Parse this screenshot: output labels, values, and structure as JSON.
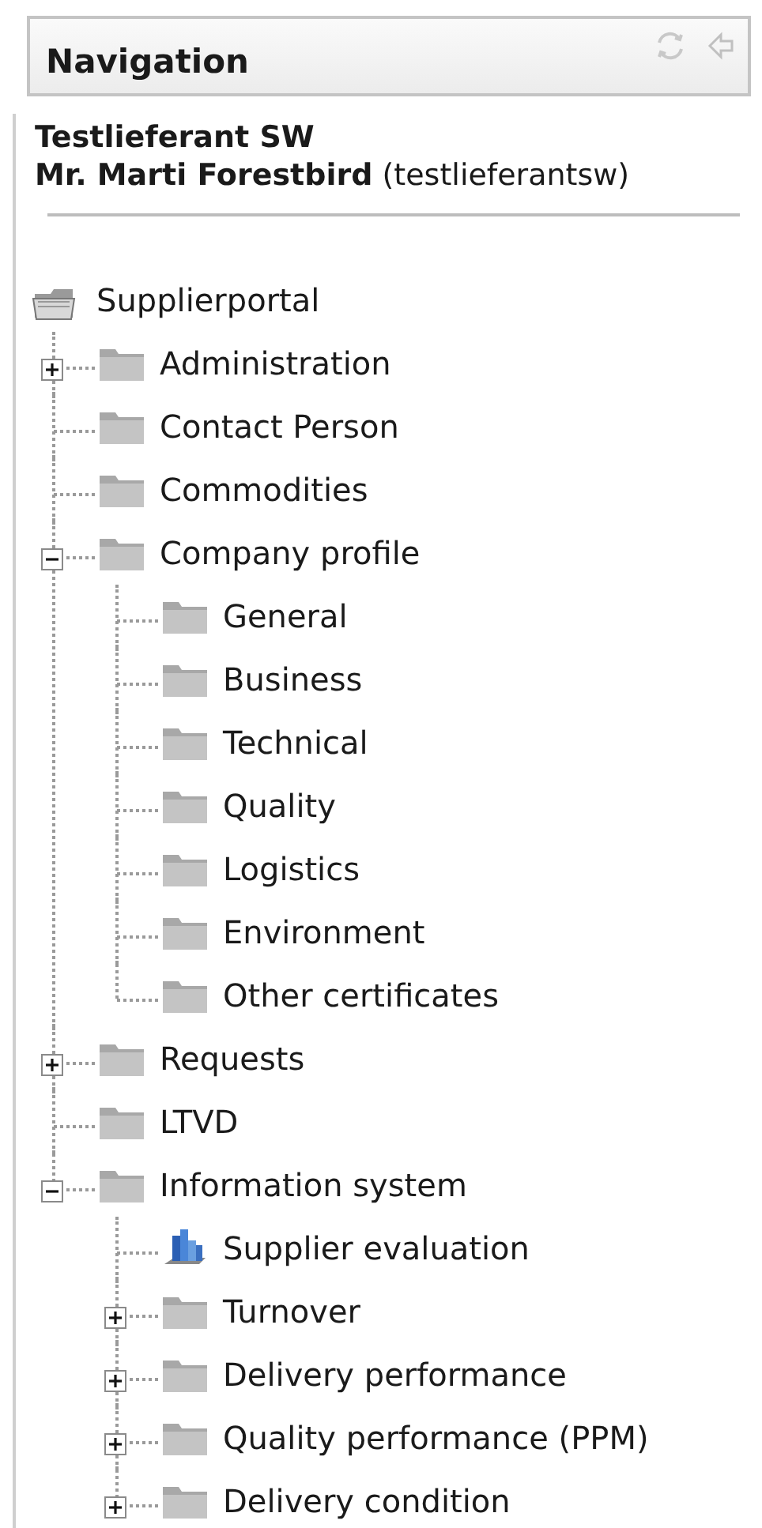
{
  "panel": {
    "title": "Navigation"
  },
  "user": {
    "company": "Testlieferant SW",
    "name": "**Mr. Marti Forestbird** (testlieferantsw)"
  },
  "tree": {
    "label": "Supplierportal",
    "kind": "root",
    "children": [
      {
        "label": "Administration",
        "kind": "folder",
        "expanded": false
      },
      {
        "label": "Contact Person",
        "kind": "folder"
      },
      {
        "label": "Commodities",
        "kind": "folder"
      },
      {
        "label": "Company profile",
        "kind": "folder",
        "expanded": true,
        "children": [
          {
            "label": "General",
            "kind": "folder"
          },
          {
            "label": "Business",
            "kind": "folder"
          },
          {
            "label": "Technical",
            "kind": "folder"
          },
          {
            "label": "Quality",
            "kind": "folder"
          },
          {
            "label": "Logistics",
            "kind": "folder"
          },
          {
            "label": "Environment",
            "kind": "folder"
          },
          {
            "label": "Other certificates",
            "kind": "folder"
          }
        ]
      },
      {
        "label": "Requests",
        "kind": "folder",
        "expanded": false
      },
      {
        "label": "LTVD",
        "kind": "folder"
      },
      {
        "label": "Information system",
        "kind": "folder",
        "expanded": true,
        "children": [
          {
            "label": "Supplier evaluation",
            "kind": "report"
          },
          {
            "label": "Turnover",
            "kind": "folder",
            "expanded": false
          },
          {
            "label": "Delivery performance",
            "kind": "folder",
            "expanded": false
          },
          {
            "label": "Quality performance (PPM)",
            "kind": "folder",
            "expanded": false
          },
          {
            "label": "Delivery condition",
            "kind": "folder",
            "expanded": false
          }
        ]
      }
    ]
  }
}
